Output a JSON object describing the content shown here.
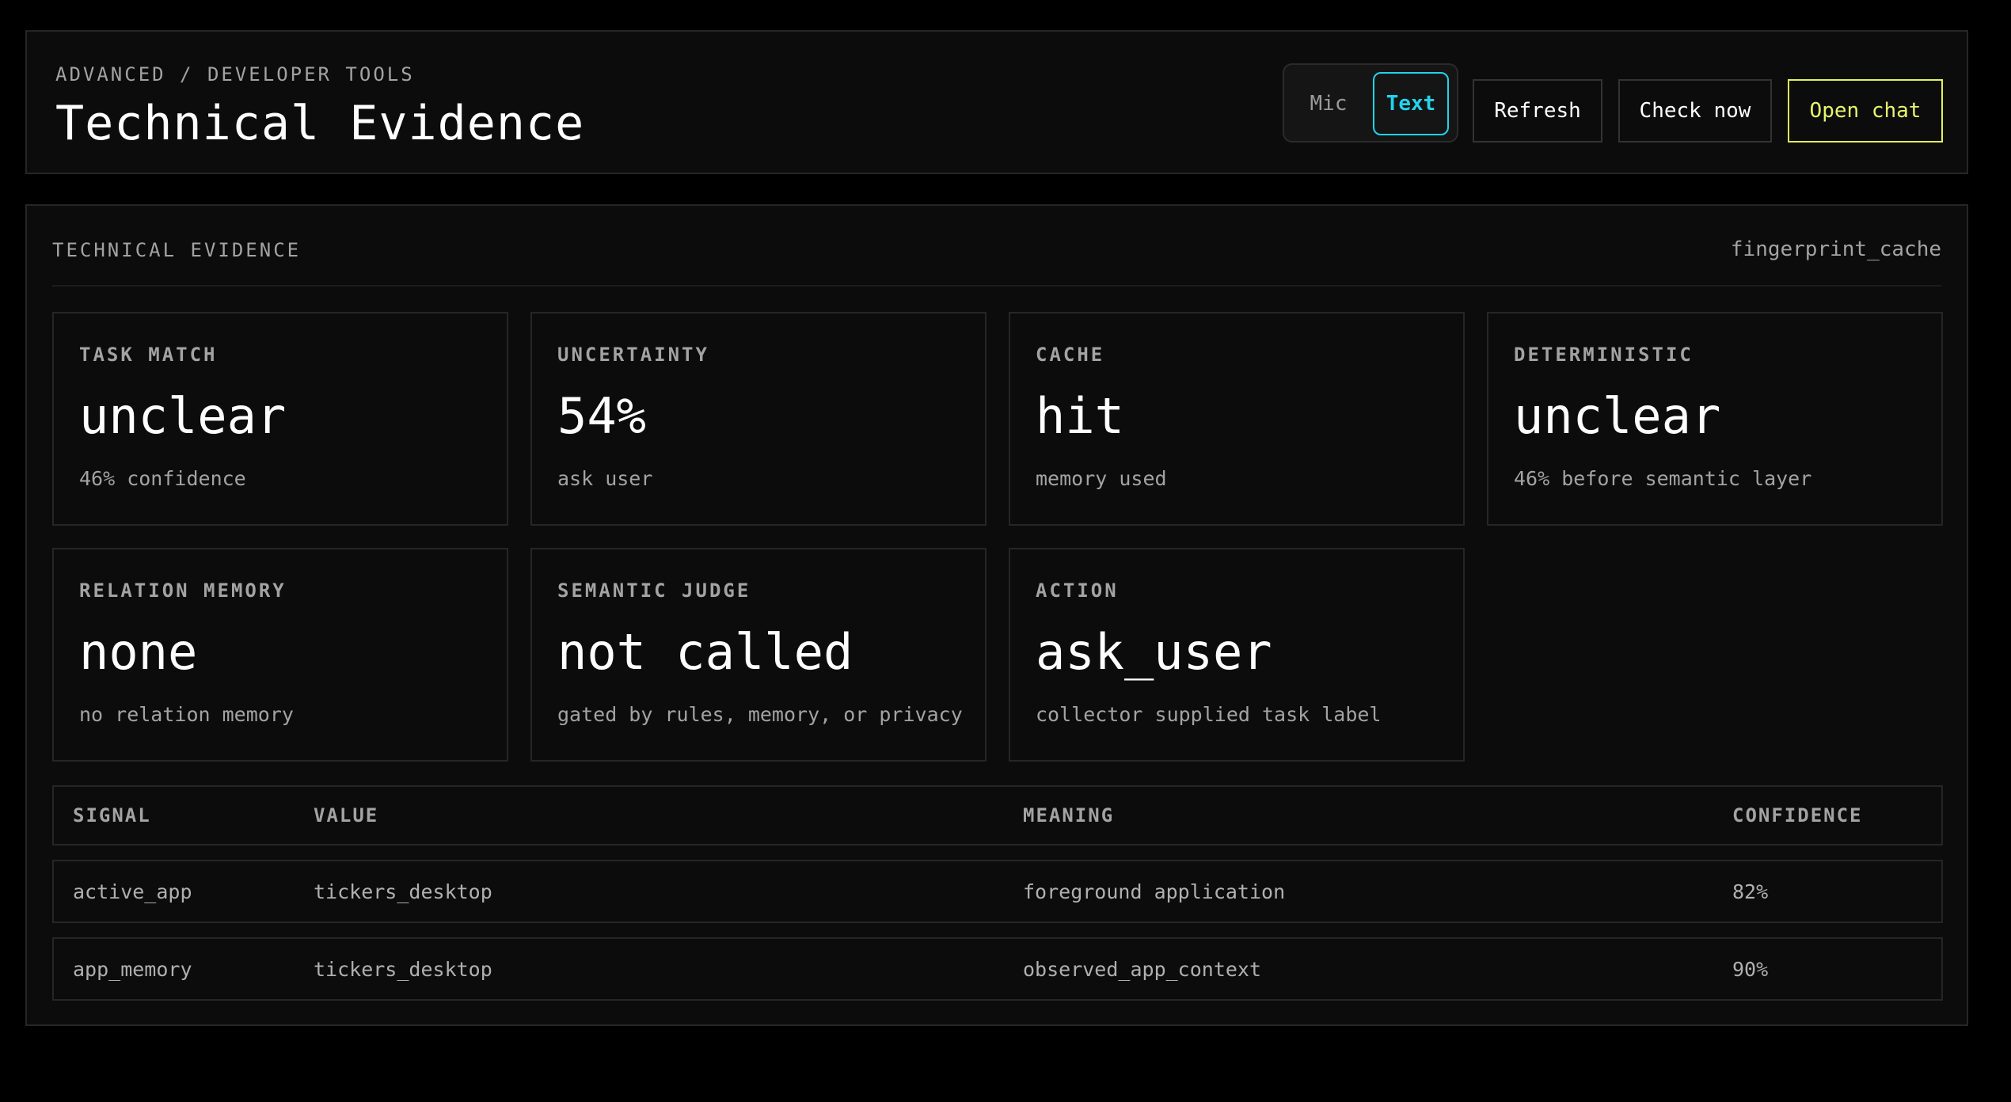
{
  "header": {
    "breadcrumb": "ADVANCED / DEVELOPER TOOLS",
    "title": "Technical Evidence",
    "mode_toggle": {
      "options": [
        "Mic",
        "Text"
      ],
      "selected": "Text"
    },
    "buttons": {
      "refresh": "Refresh",
      "check_now": "Check now",
      "open_chat": "Open chat"
    }
  },
  "panel": {
    "heading": "TECHNICAL EVIDENCE",
    "source": "fingerprint_cache",
    "cards": [
      {
        "label": "TASK MATCH",
        "value": "unclear",
        "sub": "46% confidence"
      },
      {
        "label": "UNCERTAINTY",
        "value": "54%",
        "sub": "ask user"
      },
      {
        "label": "CACHE",
        "value": "hit",
        "sub": "memory used"
      },
      {
        "label": "DETERMINISTIC",
        "value": "unclear",
        "sub": "46% before semantic layer"
      },
      {
        "label": "RELATION MEMORY",
        "value": "none",
        "sub": "no relation memory"
      },
      {
        "label": "SEMANTIC JUDGE",
        "value": "not called",
        "sub": "gated by rules, memory, or privacy"
      },
      {
        "label": "ACTION",
        "value": "ask_user",
        "sub": "collector supplied task label"
      }
    ],
    "table": {
      "columns": [
        "SIGNAL",
        "VALUE",
        "MEANING",
        "CONFIDENCE"
      ],
      "rows": [
        {
          "signal": "active_app",
          "value": "tickers_desktop",
          "meaning": "foreground application",
          "confidence": "82%"
        },
        {
          "signal": "app_memory",
          "value": "tickers_desktop",
          "meaning": "observed_app_context",
          "confidence": "90%"
        }
      ]
    }
  },
  "colors": {
    "background": "#000000",
    "surface": "#0c0c0c",
    "border": "#262626",
    "muted_text": "#a3a3a3",
    "accent_cyan": "#22d3ee",
    "accent_yellow": "#e7f56b"
  }
}
